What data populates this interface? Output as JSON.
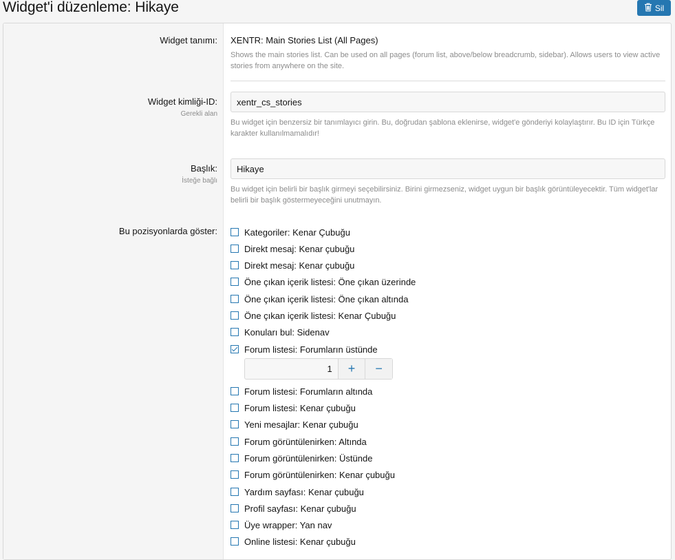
{
  "header": {
    "title": "Widget'i düzenleme: Hikaye",
    "delete_label": "Sil"
  },
  "form": {
    "definition": {
      "label": "Widget tanımı:",
      "value": "XENTR: Main Stories List (All Pages)",
      "explain": "Shows the main stories list. Can be used on all pages (forum list, above/below breadcrumb, sidebar). Allows users to view active stories from anywhere on the site."
    },
    "widget_key": {
      "label": "Widget kimliği-ID:",
      "sublabel": "Gerekli alan",
      "value": "xentr_cs_stories",
      "explain": "Bu widget için benzersiz bir tanımlayıcı girin. Bu, doğrudan şablona eklenirse, widget'e gönderiyi kolaylaştırır. Bu ID için Türkçe karakter kullanılmamalıdır!"
    },
    "title": {
      "label": "Başlık:",
      "sublabel": "İsteğe bağlı",
      "value": "Hikaye",
      "explain": "Bu widget için belirli bir başlık girmeyi seçebilirsiniz. Birini girmezseniz, widget uygun bir başlık görüntüleyecektir. Tüm widget'lar belirli bir başlık göstermeyeceğini unutmayın."
    },
    "positions": {
      "label": "Bu pozisyonlarda göster:",
      "items": [
        {
          "label": "Kategoriler: Kenar Çubuğu",
          "checked": false
        },
        {
          "label": "Direkt mesaj: Kenar çubuğu",
          "checked": false
        },
        {
          "label": "Direkt mesaj: Kenar çubuğu",
          "checked": false
        },
        {
          "label": "Öne çıkan içerik listesi: Öne çıkan üzerinde",
          "checked": false
        },
        {
          "label": "Öne çıkan içerik listesi: Öne çıkan altında",
          "checked": false
        },
        {
          "label": "Öne çıkan içerik listesi: Kenar Çubuğu",
          "checked": false
        },
        {
          "label": "Konuları bul: Sidenav",
          "checked": false
        },
        {
          "label": "Forum listesi: Forumların üstünde",
          "checked": true
        },
        {
          "label": "Forum listesi: Forumların altında",
          "checked": false
        },
        {
          "label": "Forum listesi: Kenar çubuğu",
          "checked": false
        },
        {
          "label": "Yeni mesajlar: Kenar çubuğu",
          "checked": false
        },
        {
          "label": "Forum görüntülenirken: Altında",
          "checked": false
        },
        {
          "label": "Forum görüntülenirken: Üstünde",
          "checked": false
        },
        {
          "label": "Forum görüntülenirken: Kenar çubuğu",
          "checked": false
        },
        {
          "label": "Yardım sayfası: Kenar çubuğu",
          "checked": false
        },
        {
          "label": "Profil sayfası: Kenar çubuğu",
          "checked": false
        },
        {
          "label": "Üye wrapper: Yan nav",
          "checked": false
        },
        {
          "label": "Online listesi: Kenar çubuğu",
          "checked": false
        }
      ],
      "order_value": "1",
      "plus": "+",
      "minus": "−"
    }
  },
  "colors": {
    "accent": "#2577b1",
    "label_bg": "#f5f5f5",
    "muted_text": "#8c8c8c"
  },
  "icons": {
    "delete": "trash-icon",
    "stepper_up": "plus-icon",
    "stepper_down": "minus-icon"
  }
}
